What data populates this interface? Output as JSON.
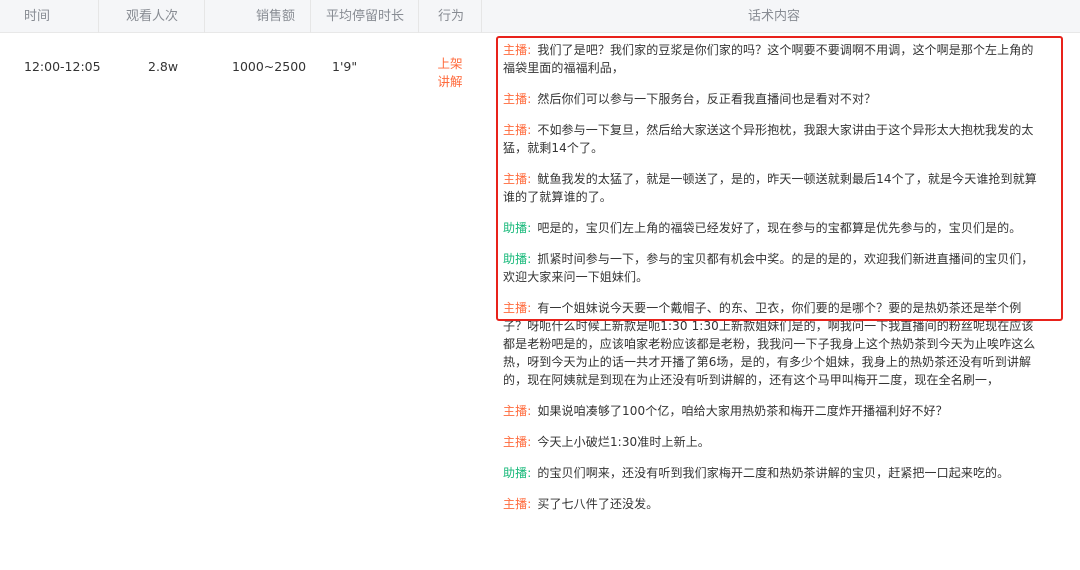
{
  "table": {
    "columns": {
      "time": "时间",
      "viewers": "观看人次",
      "sales": "销售额",
      "avg_stay": "平均停留时长",
      "action": "行为",
      "script": "话术内容"
    },
    "row": {
      "time": "12:00-12:05",
      "viewers": "2.8w",
      "sales": "1000~2500",
      "avg_stay": "1'9\"",
      "action_line1": "上架",
      "action_line2": "讲解"
    }
  },
  "speakers": {
    "host": "主播:",
    "assistant": "助播:"
  },
  "script_lines": [
    {
      "speaker": "host",
      "text": "我们了是吧？我们家的豆浆是你们家的吗？这个啊要不要调啊不用调，这个啊是那个左上角的福袋里面的福福利品，"
    },
    {
      "speaker": "host",
      "text": "然后你们可以参与一下服务台，反正看我直播间也是看对不对？"
    },
    {
      "speaker": "host",
      "text": "不如参与一下复旦，然后给大家送这个异形抱枕，我跟大家讲由于这个异形太大抱枕我发的太猛，就剩14个了。"
    },
    {
      "speaker": "host",
      "text": "鱿鱼我发的太猛了，就是一顿送了，是的，昨天一顿送就剩最后14个了，就是今天谁抢到就算谁的了就算谁的了。"
    },
    {
      "speaker": "assistant",
      "text": "吧是的，宝贝们左上角的福袋已经发好了，现在参与的宝都算是优先参与的，宝贝们是的。"
    },
    {
      "speaker": "assistant",
      "text": "抓紧时间参与一下，参与的宝贝都有机会中奖。的是的是的，欢迎我们新进直播间的宝贝们，欢迎大家来问一下姐妹们。"
    },
    {
      "speaker": "host",
      "text": "有一个姐妹说今天要一个戴帽子、的东、卫衣，你们要的是哪个？要的是热奶茶还是举个例子？呀呃什么时候上新款是呃1:30 1:30上新款姐妹们是的，啊我问一下我直播间的粉丝呢现在应该都是老粉吧是的，应该咱家老粉应该都是老粉，我我问一下子我身上这个热奶茶到今天为止唉咋这么热，呀到今天为止的话一共才开播了第6场，是的，有多少个姐妹，我身上的热奶茶还没有听到讲解的，现在阿姨就是到现在为止还没有听到讲解的，还有这个马甲叫梅开二度，现在全名刷一，"
    },
    {
      "speaker": "host",
      "text": "如果说咱凑够了100个亿，咱给大家用热奶茶和梅开二度炸开播福利好不好？"
    },
    {
      "speaker": "host",
      "text": "今天上小破烂1:30准时上新上。"
    },
    {
      "speaker": "assistant",
      "text": "的宝贝们啊来，还没有听到我们家梅开二度和热奶茶讲解的宝贝，赶紧把一口起来吃的。"
    },
    {
      "speaker": "host",
      "text": "买了七八件了还没发。"
    }
  ],
  "colors": {
    "host": "#ff6b3d",
    "assistant": "#18b97a",
    "highlight_border": "#e8221b",
    "header_bg": "#f5f6f8"
  }
}
